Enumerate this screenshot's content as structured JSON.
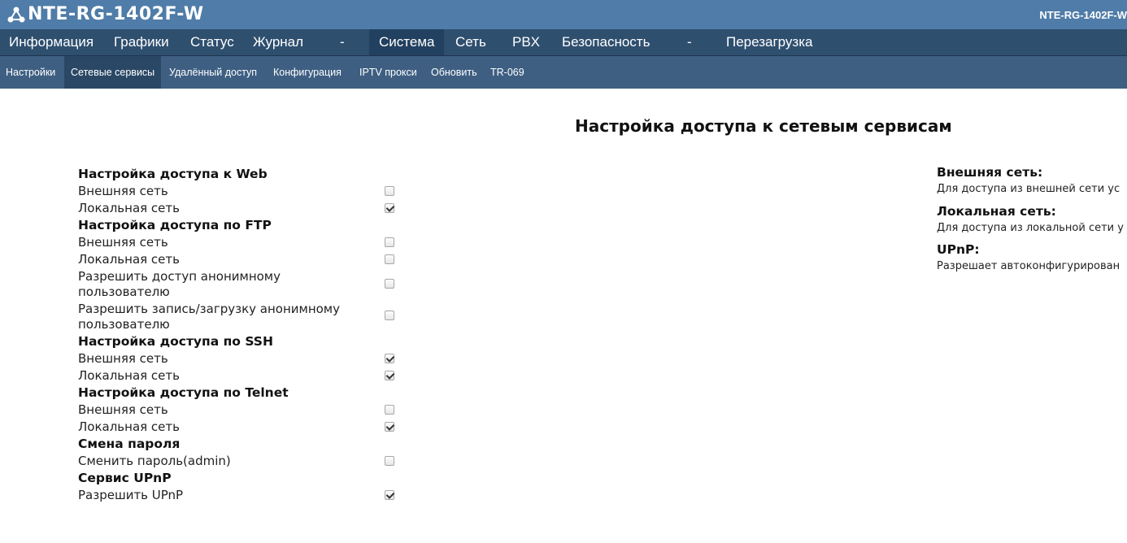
{
  "header": {
    "logo_text": "NTE-RG-1402F-W",
    "model_right": "NTE-RG-1402F-W",
    "bar_color": "#4f7ca8"
  },
  "mainnav": {
    "items": [
      {
        "label": "Информация"
      },
      {
        "label": "Графики"
      },
      {
        "label": "Статус"
      },
      {
        "label": "Журнал"
      },
      {
        "label": "-"
      },
      {
        "label": "Система",
        "active": true
      },
      {
        "label": "Сеть"
      },
      {
        "label": "PBX"
      },
      {
        "label": "Безопасность"
      },
      {
        "label": "-"
      },
      {
        "label": "Перезагрузка"
      }
    ]
  },
  "subnav": {
    "items": [
      {
        "label": "Настройки"
      },
      {
        "label": "Сетевые сервисы",
        "active": true
      },
      {
        "label": "Удалённый доступ"
      },
      {
        "label": "Конфигурация"
      },
      {
        "label": "IPTV прокси"
      },
      {
        "label": "Обновить"
      },
      {
        "label": "TR-069"
      }
    ]
  },
  "page": {
    "title": "Настройка доступа к сетевым сервисам"
  },
  "settings": {
    "web": {
      "heading": "Настройка доступа к Web",
      "external": {
        "label": "Внешняя сеть",
        "checked": false
      },
      "local": {
        "label": "Локальная сеть",
        "checked": true
      }
    },
    "ftp": {
      "heading": "Настройка доступа по FTP",
      "external": {
        "label": "Внешняя сеть",
        "checked": false
      },
      "local": {
        "label": "Локальная сеть",
        "checked": false
      },
      "anon_access": {
        "label": "Разрешить доступ анонимному пользователю",
        "checked": false
      },
      "anon_write": {
        "label": "Разрешить запись/загрузку анонимному пользователю",
        "checked": false
      }
    },
    "ssh": {
      "heading": "Настройка доступа по SSH",
      "external": {
        "label": "Внешняя сеть",
        "checked": true
      },
      "local": {
        "label": "Локальная сеть",
        "checked": true
      }
    },
    "telnet": {
      "heading": "Настройка доступа по Telnet",
      "external": {
        "label": "Внешняя сеть",
        "checked": false
      },
      "local": {
        "label": "Локальная сеть",
        "checked": true
      }
    },
    "password": {
      "heading": "Смена пароля",
      "change_admin": {
        "label": "Сменить пароль(admin)",
        "checked": false
      }
    },
    "upnp": {
      "heading": "Сервис UPnP",
      "enable": {
        "label": "Разрешить UPnP",
        "checked": true
      }
    }
  },
  "help": {
    "external_title": "Внешняя сеть:",
    "external_text": "Для доступа из внешней сети ус",
    "local_title": "Локальная сеть:",
    "local_text": "Для доступа из локальной сети у",
    "upnp_title": "UPnP:",
    "upnp_text": "Разрешает автоконфигурирован"
  }
}
